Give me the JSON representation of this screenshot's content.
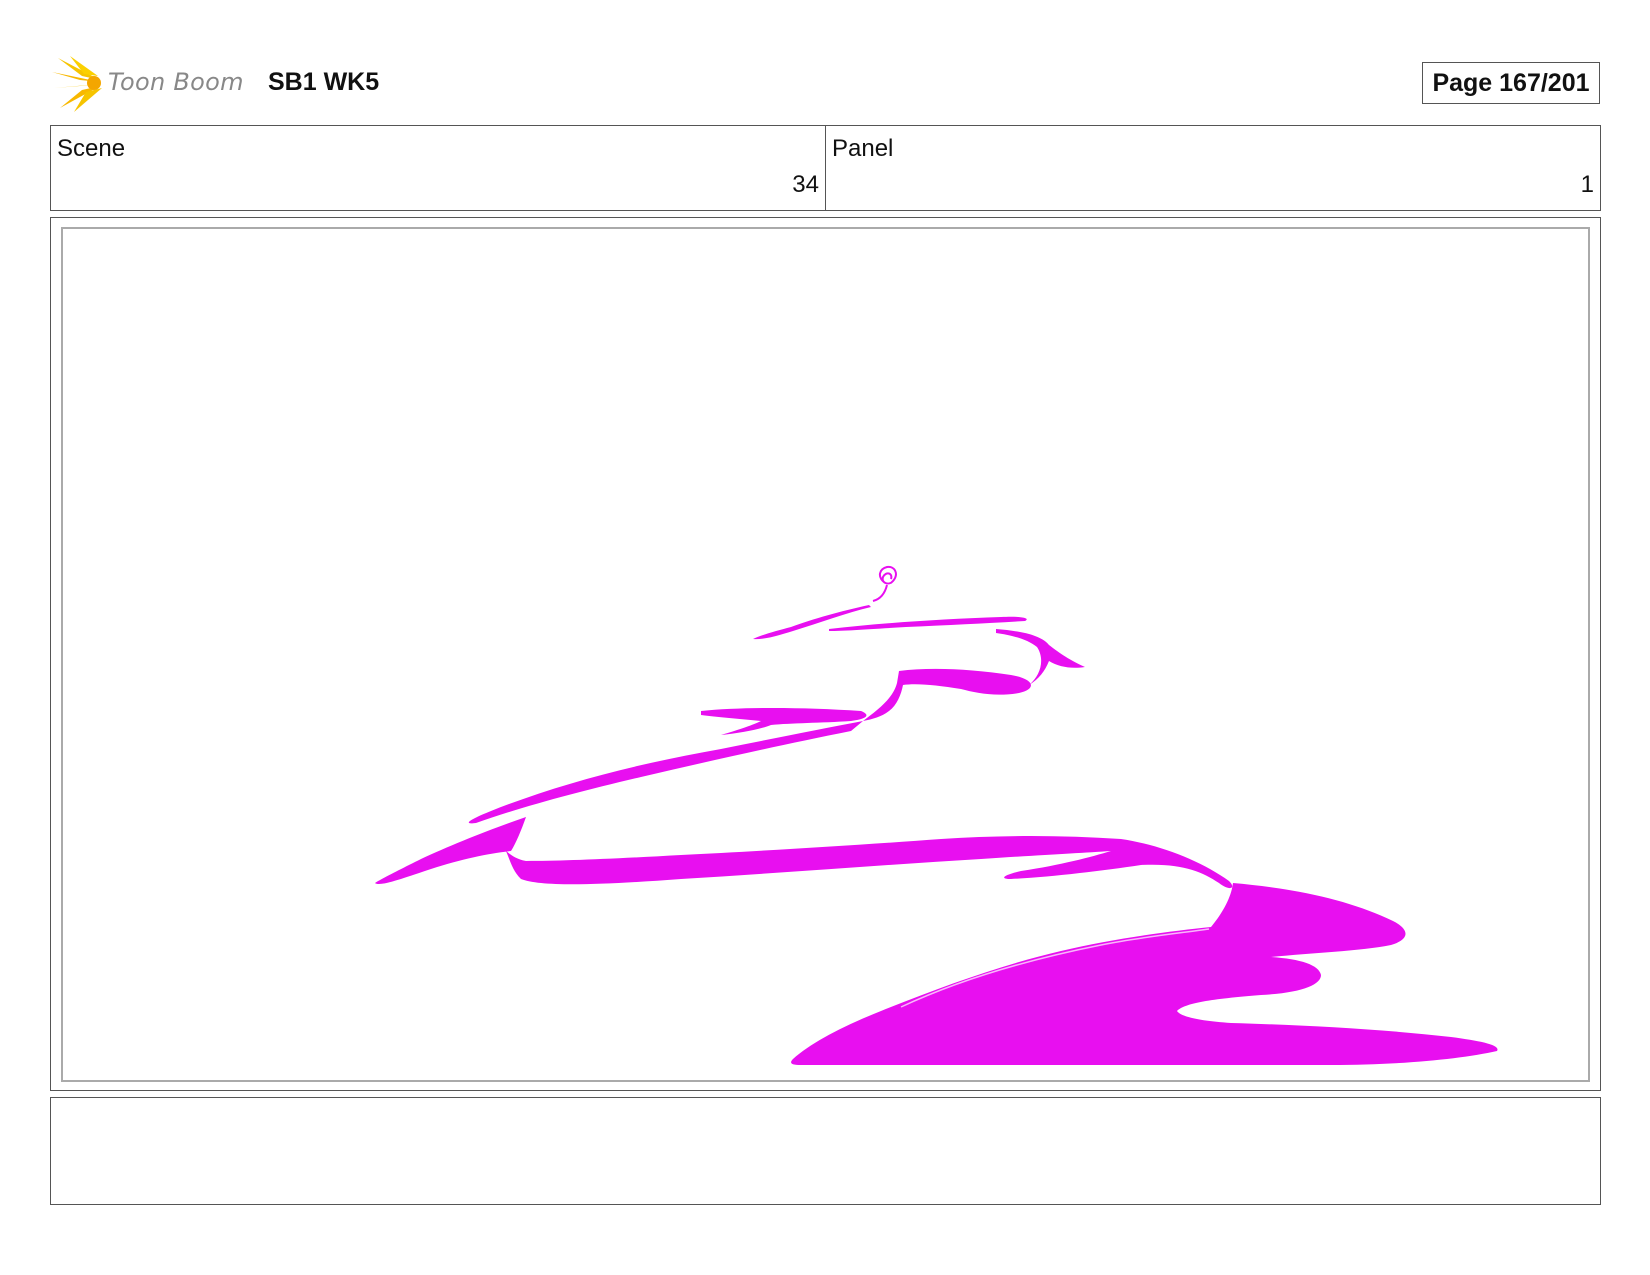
{
  "header": {
    "logo_text": "Toon Boom",
    "logo_icon": "starburst-logo-icon",
    "project_title": "SB1 WK5",
    "page_label": "Page 167/201"
  },
  "info": {
    "scene_label": "Scene",
    "scene_value": "34",
    "panel_label": "Panel",
    "panel_value": "1"
  },
  "drawing": {
    "stroke_color": "#e80ff0"
  },
  "notes": {
    "text": ""
  }
}
